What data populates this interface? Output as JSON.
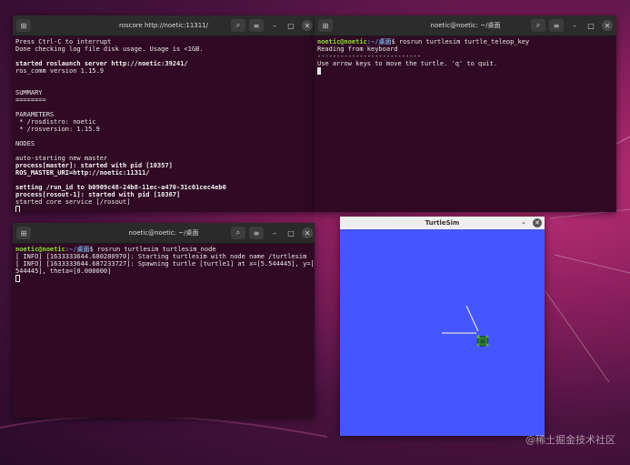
{
  "colors": {
    "terminal_bg": "#300a24",
    "prompt_user": "#8ae234",
    "prompt_path": "#729fcf",
    "turtlesim_bg": "#4556ff"
  },
  "roscore": {
    "title": "roscore http://noetic:11311/",
    "lines": [
      "Press Ctrl-C to interrupt",
      "Done checking log file disk usage. Usage is <1GB.",
      "",
      "started roslaunch server http://noetic:39241/",
      "ros_comm version 1.15.9",
      "",
      "",
      "SUMMARY",
      "========",
      "",
      "PARAMETERS",
      " * /rosdistro: noetic",
      " * /rosversion: 1.15.9",
      "",
      "NODES",
      "",
      "auto-starting new master",
      "process[master]: started with pid [10357]",
      "ROS_MASTER_URI=http://noetic:11311/",
      "",
      "setting /run_id to b0909c48-24b8-11ec-a470-31c01cec4eb0",
      "process[rosout-1]: started with pid [10367]",
      "started core service [/rosout]"
    ],
    "bold_lines": [
      3,
      17,
      18,
      20,
      21
    ]
  },
  "teleop": {
    "title": "noetic@noetic: ~/桌面",
    "prompt_user": "noetic@noetic",
    "prompt_path": ":~/桌面",
    "command": "$ rosrun turtlesim turtle_teleop_key",
    "lines": [
      "Reading from keyboard",
      "---------------------------",
      "Use arrow keys to move the turtle. 'q' to quit."
    ]
  },
  "turtlesim_node": {
    "title": "noetic@noetic: ~/桌面",
    "prompt_user": "noetic@noetic",
    "prompt_path": ":~/桌面",
    "command": "$ rosrun turtlesim turtlesim_node",
    "lines": [
      "[ INFO] [1633333644.680280970]: Starting turtlesim with node name /turtlesim",
      "[ INFO] [1633333644.687233727]: Spawning turtle [turtle1] at x=[5.544445], y=[5.",
      "544445], theta=[0.000000]"
    ]
  },
  "turtlesim": {
    "title": "TurtleSim"
  },
  "icons": {
    "new_tab": "⊞",
    "search": "⌕",
    "menu": "≡",
    "minimize": "–",
    "maximize": "□",
    "close": "✕"
  },
  "watermark": "@稀土掘金技术社区"
}
